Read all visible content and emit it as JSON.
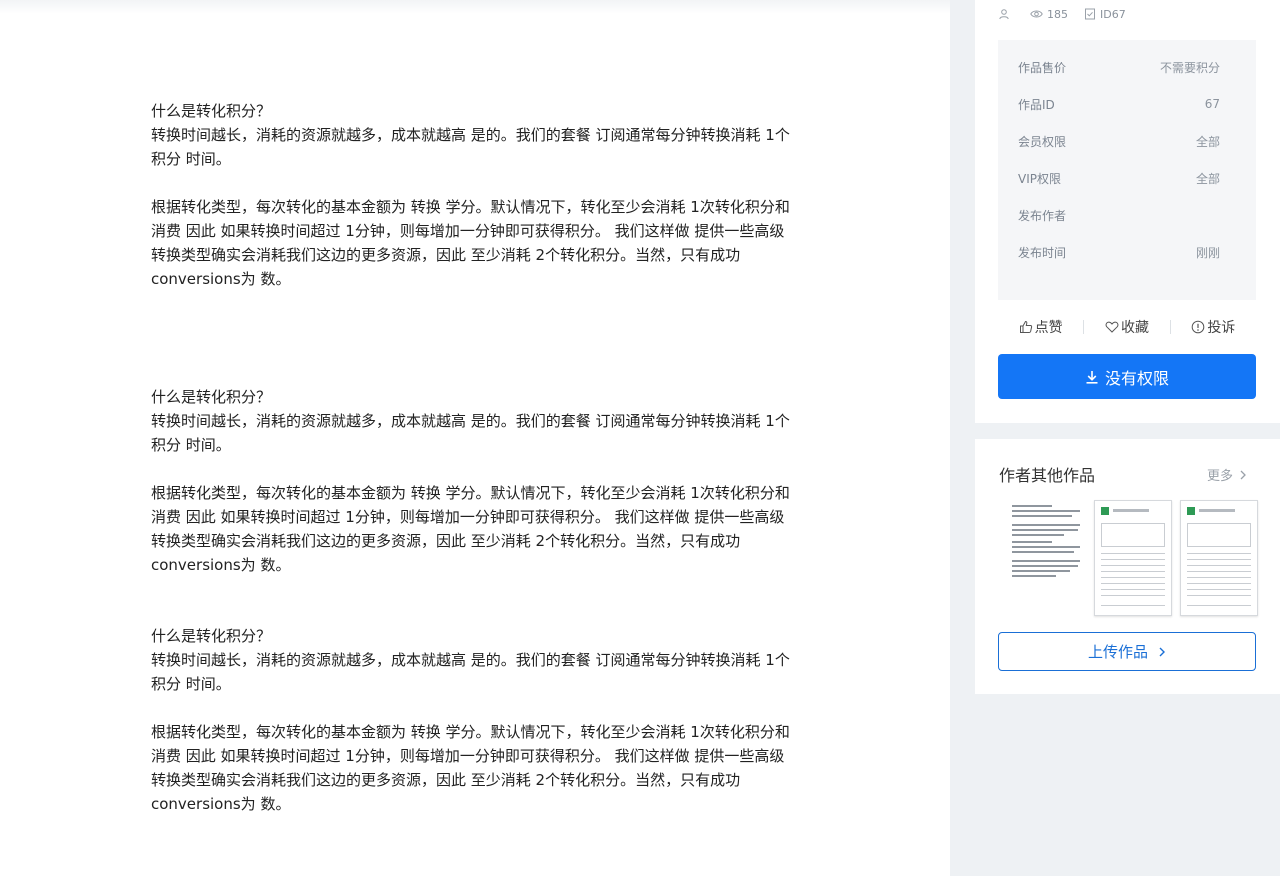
{
  "document": {
    "sections": [
      {
        "question": "什么是转化积分？",
        "paragraph1": "转换时间越长，消耗的资源就越多，成本就越高 是的。我们的套餐 订阅通常每分钟转换消耗 1个积分 时间。",
        "paragraph2": "根据转化类型，每次转化的基本金额为 转换 学分。默认情况下，转化至少会消耗 1次转化积分和消费 因此 如果转换时间超过 1分钟，则每增加一分钟即可获得积分。 我们这样做 提供一些高级 转换类型确实会消耗我们这边的更多资源，因此 至少消耗 2个转化积分。当然，只有成功 conversions为 数。"
      },
      {
        "question": "什么是转化积分？",
        "paragraph1": "转换时间越长，消耗的资源就越多，成本就越高 是的。我们的套餐 订阅通常每分钟转换消耗 1个积分 时间。",
        "paragraph2": "根据转化类型，每次转化的基本金额为 转换 学分。默认情况下，转化至少会消耗 1次转化积分和消费 因此 如果转换时间超过 1分钟，则每增加一分钟即可获得积分。 我们这样做 提供一些高级 转换类型确实会消耗我们这边的更多资源，因此 至少消耗 2个转化积分。当然，只有成功 conversions为 数。"
      },
      {
        "question": "什么是转化积分？",
        "paragraph1": "转换时间越长，消耗的资源就越多，成本就越高 是的。我们的套餐 订阅通常每分钟转换消耗 1个积分 时间。",
        "paragraph2": "根据转化类型，每次转化的基本金额为 转换 学分。默认情况下，转化至少会消耗 1次转化积分和消费 因此 如果转换时间超过 1分钟，则每增加一分钟即可获得积分。 我们这样做 提供一些高级 转换类型确实会消耗我们这边的更多资源，因此 至少消耗 2个转化积分。当然，只有成功 conversions为 数。"
      }
    ]
  },
  "meta": {
    "author_icon": "user-icon",
    "views": "185",
    "id_label": "ID67"
  },
  "info": {
    "rows": [
      {
        "label": "作品售价",
        "value": "不需要积分"
      },
      {
        "label": "作品ID",
        "value": "67"
      },
      {
        "label": "会员权限",
        "value": "全部"
      },
      {
        "label": "VIP权限",
        "value": "全部"
      },
      {
        "label": "发布作者",
        "value": ""
      },
      {
        "label": "发布时间",
        "value": "刚刚"
      }
    ]
  },
  "actions": {
    "like": "点赞",
    "favorite": "收藏",
    "report": "投诉"
  },
  "download": {
    "label": "没有权限"
  },
  "works": {
    "title": "作者其他作品",
    "more": "更多",
    "upload": "上传作品"
  },
  "colors": {
    "primary": "#1476f6",
    "outline": "#1a6fd6",
    "sidebar_bg": "#eef1f4",
    "info_bg": "#f5f6f8"
  }
}
